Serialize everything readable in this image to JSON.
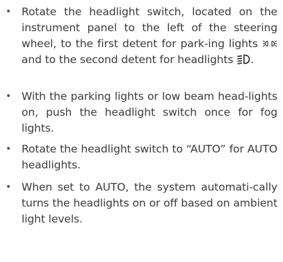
{
  "bullets": [
    {
      "text_before_icon1": "Rotate the headlight switch, located on the instrument panel to the left of the steering wheel, to the first detent for park-ing lights ",
      "text_between_icons": " and to the second detent for headlights ",
      "text_after_icon2": ".",
      "icon1": "parking-lights-icon",
      "icon2": "low-beam-headlight-icon"
    },
    {
      "text": "With the parking lights or low beam head-lights on, push the headlight switch once for fog lights."
    },
    {
      "text": "Rotate the headlight switch to “AUTO” for AUTO headlights."
    },
    {
      "text": "When set to AUTO, the system automati-cally turns the headlights on or off based on ambient light levels."
    }
  ],
  "bullet_symbol": "•",
  "colors": {
    "text": "#3a3a3a",
    "background": "#ffffff"
  }
}
